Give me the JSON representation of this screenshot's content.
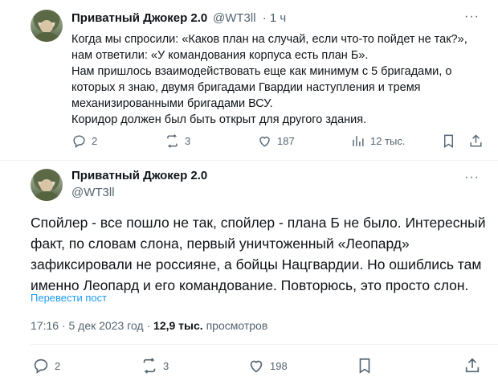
{
  "tweet1": {
    "author_name": "Приватный Джокер 2.0",
    "handle": "@WT3ll",
    "time": "· 1 ч",
    "more_label": "···",
    "text": "Когда мы спросили: «Каков план на случай, если что-то пойдет не так?»,\nнам ответили: «У командования корпуса есть план Б».\nНам пришлось взаимодействовать еще как минимум с 5 бригадами, о\nкоторых я знаю, двумя бригадами Гвардии наступления и тремя\nмеханизированными бригадами ВСУ.\nКоридор должен был быть открыт для другого здания.",
    "replies": "2",
    "reposts": "3",
    "likes": "187",
    "views": "12 тыс."
  },
  "tweet2": {
    "author_name": "Приватный Джокер 2.0",
    "handle": "@WT3ll",
    "more_label": "···",
    "text": "Спойлер - все пошло не так, спойлер - плана Б не было. Интересный\nфакт, по словам слона, первый уничтоженный «Леопард»\nзафиксировали не россияне, а бойцы Нацгвардии. Но ошиблись там\nименно Леопард и его командование. Повторюсь, это просто слон.",
    "translate": "Перевести пост",
    "timestamp": "17:16 · 5 дек 2023 год · ",
    "views_count": "12,9 тыс.",
    "views_label": " просмотров",
    "replies": "2",
    "reposts": "3",
    "likes": "198"
  },
  "icons": [
    "reply-icon",
    "repost-icon",
    "like-icon",
    "views-icon",
    "bookmark-icon",
    "share-icon"
  ]
}
